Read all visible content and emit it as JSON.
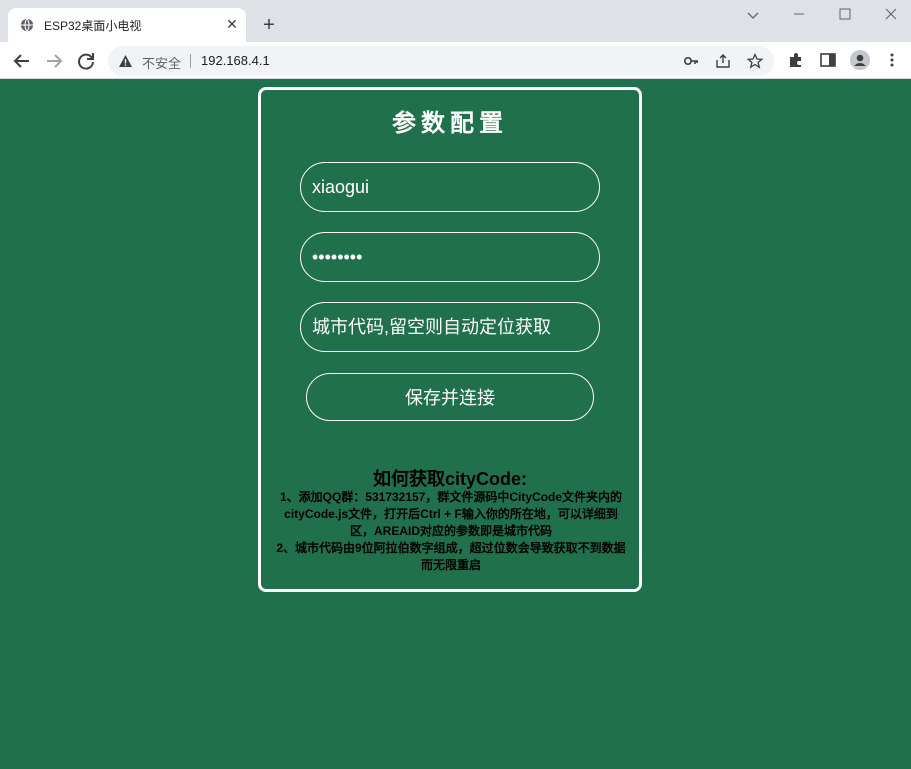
{
  "browser": {
    "tab_title": "ESP32桌面小电视",
    "security_label": "不安全",
    "url": "192.168.4.1"
  },
  "form": {
    "title": "参数配置",
    "ssid_value": "xiaogui",
    "password_value": "••••••••",
    "citycode_placeholder": "城市代码,留空则自动定位获取",
    "save_label": "保存并连接"
  },
  "help": {
    "title": "如何获取cityCode:",
    "line1": "1、添加QQ群：531732157，群文件源码中CityCode文件夹内的cityCode.js文件，打开后Ctrl + F输入你的所在地，可以详细到区，AREAID对应的参数即是城市代码",
    "line2": "2、城市代码由9位阿拉伯数字组成，超过位数会导致获取不到数据而无限重启"
  },
  "colors": {
    "page_background": "#1f704b",
    "panel_border": "#ffffff"
  }
}
